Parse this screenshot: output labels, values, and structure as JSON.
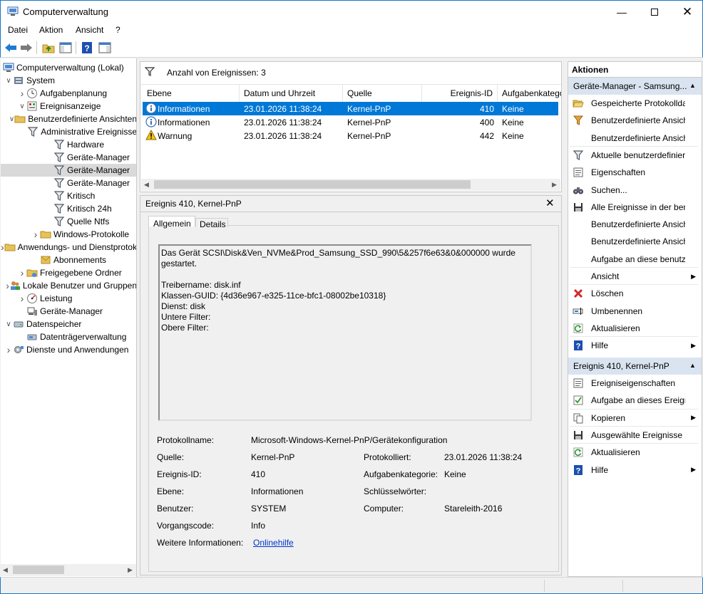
{
  "window": {
    "title": "Computerverwaltung"
  },
  "menu": [
    "Datei",
    "Aktion",
    "Ansicht",
    "?"
  ],
  "tree": [
    {
      "label": "Computerverwaltung (Lokal)",
      "icon": "computer-management-icon"
    },
    {
      "label": "System",
      "icon": "system-tools-icon"
    },
    {
      "label": "Aufgabenplanung",
      "icon": "clock-icon"
    },
    {
      "label": "Ereignisanzeige",
      "icon": "event-viewer-icon"
    },
    {
      "label": "Benutzerdefinierte Ansichten",
      "icon": "folder-icon"
    },
    {
      "label": "Administrative Ereignisse",
      "icon": "filter-icon"
    },
    {
      "label": "Hardware",
      "icon": "filter-icon"
    },
    {
      "label": "Geräte-Manager",
      "icon": "filter-icon"
    },
    {
      "label": "Geräte-Manager",
      "icon": "filter-icon"
    },
    {
      "label": "Geräte-Manager",
      "icon": "filter-icon"
    },
    {
      "label": "Kritisch",
      "icon": "filter-icon"
    },
    {
      "label": "Kritisch 24h",
      "icon": "filter-icon"
    },
    {
      "label": "Quelle Ntfs",
      "icon": "filter-icon"
    },
    {
      "label": "Windows-Protokolle",
      "icon": "folder-icon"
    },
    {
      "label": "Anwendungs- und Dienstprotokolle",
      "icon": "folder-icon"
    },
    {
      "label": "Abonnements",
      "icon": "subscriptions-icon"
    },
    {
      "label": "Freigegebene Ordner",
      "icon": "shared-folder-icon"
    },
    {
      "label": "Lokale Benutzer und Gruppen",
      "icon": "users-icon"
    },
    {
      "label": "Leistung",
      "icon": "performance-icon"
    },
    {
      "label": "Geräte-Manager",
      "icon": "device-manager-icon"
    },
    {
      "label": "Datenspeicher",
      "icon": "storage-icon"
    },
    {
      "label": "Datenträgerverwaltung",
      "icon": "disk-management-icon"
    },
    {
      "label": "Dienste und Anwendungen",
      "icon": "services-icon"
    }
  ],
  "list": {
    "header": "Anzahl von Ereignissen: 3",
    "columns": [
      "Ebene",
      "Datum und Uhrzeit",
      "Quelle",
      "Ereignis-ID",
      "Aufgabenkategorie"
    ],
    "rows": [
      {
        "level": "Informationen",
        "date": "23.01.2026 11:38:24",
        "source": "Kernel-PnP",
        "id": "410",
        "task": "Keine",
        "icon": "info-icon"
      },
      {
        "level": "Informationen",
        "date": "23.01.2026 11:38:24",
        "source": "Kernel-PnP",
        "id": "400",
        "task": "Keine",
        "icon": "info-icon"
      },
      {
        "level": "Warnung",
        "date": "23.01.2026 11:38:24",
        "source": "Kernel-PnP",
        "id": "442",
        "task": "Keine",
        "icon": "warning-icon"
      }
    ]
  },
  "detail": {
    "title": "Ereignis 410, Kernel-PnP",
    "tabs": [
      "Allgemein",
      "Details"
    ],
    "message": [
      "Das Gerät SCSI\\Disk&Ven_NVMe&Prod_Samsung_SSD_990\\5&257f6e63&0&000000 wurde",
      "gestartet.",
      "",
      "Treibername: disk.inf",
      "Klassen-GUID: {4d36e967-e325-11ce-bfc1-08002be10318}",
      "Dienst: disk",
      "Untere Filter:",
      "Obere Filter:"
    ],
    "fields": {
      "protokollname_label": "Protokollname:",
      "protokollname": "Microsoft-Windows-Kernel-PnP/Gerätekonfiguration",
      "quelle_label": "Quelle:",
      "quelle": "Kernel-PnP",
      "protokolliert_label": "Protokolliert:",
      "protokolliert": "23.01.2026 11:38:24",
      "id_label": "Ereignis-ID:",
      "id": "410",
      "aufgabe_label": "Aufgabenkategorie:",
      "aufgabe": "Keine",
      "ebene_label": "Ebene:",
      "ebene": "Informationen",
      "schluessel_label": "Schlüsselwörter:",
      "schluessel": "",
      "benutzer_label": "Benutzer:",
      "benutzer": "SYSTEM",
      "computer_label": "Computer:",
      "computer": "Stareleith-2016",
      "vorgang_label": "Vorgangscode:",
      "vorgang": "Info",
      "weitere_label": "Weitere Informationen:",
      "weitere_link": "Onlinehilfe"
    }
  },
  "actions": {
    "title": "Aktionen",
    "section1": "Geräte-Manager - Samsung...",
    "items1": [
      {
        "label": "Gespeicherte Protokolldatei öffnen...",
        "icon": "open-folder-icon",
        "sub": false
      },
      {
        "label": "Benutzerdefinierte Ansicht erstellen...",
        "icon": "filter-create-icon",
        "sub": false
      },
      {
        "label": "Benutzerdefinierte Ansicht importieren...",
        "icon": "",
        "sub": false
      },
      {
        "label": "Aktuelle benutzerdefinierte Ansicht filtern...",
        "icon": "filter-icon",
        "sub": false
      },
      {
        "label": "Eigenschaften",
        "icon": "properties-icon",
        "sub": false
      },
      {
        "label": "Suchen...",
        "icon": "binoculars-icon",
        "sub": false
      },
      {
        "label": "Alle Ereignisse in der benutzerdefinierten Ansicht speichern...",
        "icon": "save-icon",
        "sub": false
      },
      {
        "label": "Benutzerdefinierte Ansicht exportieren...",
        "icon": "",
        "sub": false
      },
      {
        "label": "Benutzerdefinierte Ansicht kopieren...",
        "icon": "",
        "sub": false
      },
      {
        "label": "Aufgabe an diese benutzerdefinierte Ansicht anfügen...",
        "icon": "",
        "sub": false
      },
      {
        "label": "Ansicht",
        "icon": "",
        "sub": true
      },
      {
        "label": "Löschen",
        "icon": "delete-icon",
        "sub": false
      },
      {
        "label": "Umbenennen",
        "icon": "rename-icon",
        "sub": false
      },
      {
        "label": "Aktualisieren",
        "icon": "refresh-icon",
        "sub": false
      },
      {
        "label": "Hilfe",
        "icon": "help-icon",
        "sub": true
      }
    ],
    "section2": "Ereignis 410, Kernel-PnP",
    "items2": [
      {
        "label": "Ereigniseigenschaften",
        "icon": "event-properties-icon",
        "sub": false
      },
      {
        "label": "Aufgabe an dieses Ereignis anfügen...",
        "icon": "task-icon",
        "sub": false
      },
      {
        "label": "Kopieren",
        "icon": "copy-icon",
        "sub": true
      },
      {
        "label": "Ausgewählte Ereignisse speichern...",
        "icon": "save-icon",
        "sub": false
      },
      {
        "label": "Aktualisieren",
        "icon": "refresh-icon",
        "sub": false
      },
      {
        "label": "Hilfe",
        "icon": "help-icon",
        "sub": true
      }
    ]
  },
  "colors": {
    "accent": "#0078d7",
    "selection": "#cce8ff",
    "header": "#d9e4f0",
    "link": "#0033cc"
  }
}
